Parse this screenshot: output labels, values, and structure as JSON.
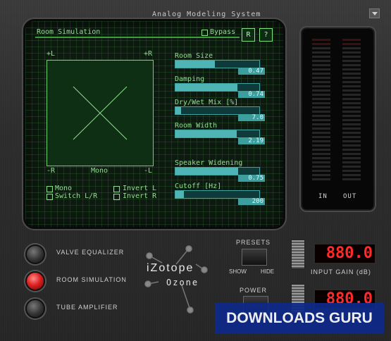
{
  "header": {
    "title": "Analog Modeling System"
  },
  "screen": {
    "section_title": "Room Simulation",
    "bypass_label": "Bypass",
    "reset_label": "R",
    "help_label": "?",
    "xy": {
      "top_left": "+L",
      "top_right": "+R",
      "bottom_left": "-R",
      "bottom_center": "Mono",
      "bottom_right": "-L"
    },
    "options": {
      "mono": "Mono",
      "switch": "Switch L/R",
      "invert_l": "Invert L",
      "invert_r": "Invert R"
    },
    "sliders": [
      {
        "label": "Room Size",
        "value": "0.47",
        "fraction": 0.47
      },
      {
        "label": "Damping",
        "value": "0.74",
        "fraction": 0.74
      },
      {
        "label": "Dry/Wet Mix [%]",
        "value": "7.0",
        "fraction": 0.07
      },
      {
        "label": "Room Width",
        "value": "2.19",
        "fraction": 0.73
      },
      {
        "label": "Speaker Widening",
        "value": "0.75",
        "fraction": 0.75
      },
      {
        "label": "Cutoff [Hz]",
        "value": "200",
        "fraction": 0.1
      }
    ]
  },
  "meter": {
    "in_label": "IN",
    "out_label": "OUT"
  },
  "modules": [
    {
      "label": "VALVE EQUALIZER",
      "active": false
    },
    {
      "label": "ROOM SIMULATION",
      "active": true
    },
    {
      "label": "TUBE AMPLIFIER",
      "active": false
    }
  ],
  "logo": {
    "brand": "iZotope",
    "product": "Ozone"
  },
  "presets": {
    "label": "PRESETS",
    "show": "SHOW",
    "hide": "HIDE"
  },
  "power": {
    "label": "POWER"
  },
  "input_gain": {
    "display": "880.0",
    "label": "INPUT GAIN (dB)"
  },
  "output_gain": {
    "display": "880.0"
  },
  "watermark": {
    "text": "DOWNLOADS GURU"
  },
  "colors": {
    "screen_green": "#8fe08f",
    "slider_teal": "#4fb4b4",
    "led_red": "#ff2a2a"
  }
}
